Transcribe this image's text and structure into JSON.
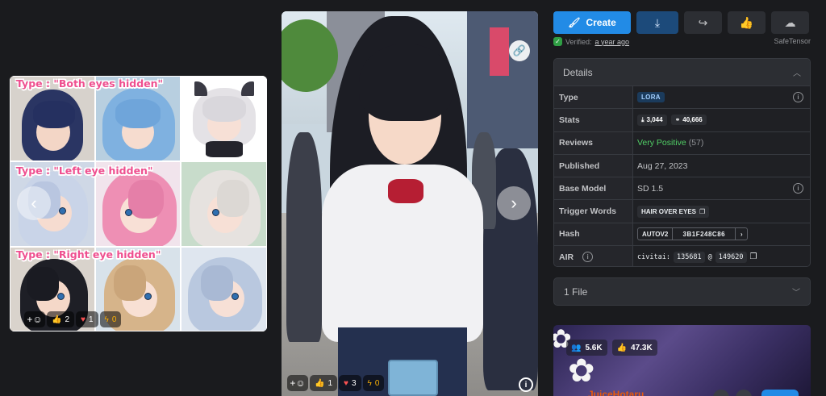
{
  "left_card": {
    "labels": [
      "Type : \"Both eyes hidden\"",
      "Type : \"Left eye hidden\"",
      "Type : \"Right eye hidden\""
    ],
    "reactions": {
      "likes": "2",
      "hearts": "1",
      "bolts": "0"
    }
  },
  "main_image": {
    "reactions": {
      "likes": "1",
      "hearts": "3",
      "bolts": "0"
    }
  },
  "actions": {
    "create_label": "Create"
  },
  "verified": {
    "label": "Verified:",
    "time": "a year ago",
    "safetensor": "SafeTensor"
  },
  "details": {
    "title": "Details",
    "rows": {
      "type_key": "Type",
      "type_val": "LORA",
      "stats_key": "Stats",
      "downloads": "3,044",
      "generations": "40,666",
      "reviews_key": "Reviews",
      "reviews_val": "Very Positive",
      "reviews_count": "(57)",
      "published_key": "Published",
      "published_val": "Aug 27, 2023",
      "base_key": "Base Model",
      "base_val": "SD 1.5",
      "trigger_key": "Trigger Words",
      "trigger_val": "HAIR OVER EYES",
      "hash_key": "Hash",
      "hash_type": "AUTOV2",
      "hash_val": "3B1F248C86",
      "air_key": "AIR",
      "air_prefix": "civitai:",
      "air_model": "135681",
      "air_at": "@",
      "air_version": "149620"
    }
  },
  "files": {
    "label": "1 File"
  },
  "creator": {
    "followers": "5.6K",
    "likes": "47.3K",
    "name": "JuiceHotaru"
  },
  "colors": {
    "accent": "#228be6",
    "positive": "#51cf66",
    "label_pink": "#ef4f8f"
  }
}
